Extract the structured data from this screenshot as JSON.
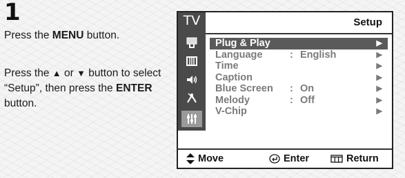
{
  "step": {
    "number": "1"
  },
  "instructions": {
    "p1_pre": "Press the ",
    "p1_bold": "MENU",
    "p1_post": " button.",
    "p2_pre": "Press the ",
    "p2_up": "▲",
    "p2_or": " or ",
    "p2_down": "▼",
    "p2_mid": " button to select “Setup”, then press the ",
    "p2_bold": "ENTER",
    "p2_post": " button."
  },
  "tv_menu": {
    "sidebar_label": "TV",
    "sidebar_icons": [
      "input-icon",
      "picture-icon",
      "sound-icon",
      "channel-icon",
      "setup-icon"
    ],
    "title": "Setup",
    "items": [
      {
        "label": "Plug & Play",
        "colon": "",
        "value": "",
        "arrow": "▶",
        "selected": true
      },
      {
        "label": "Language",
        "colon": ":",
        "value": "English",
        "arrow": "▶",
        "selected": false
      },
      {
        "label": "Time",
        "colon": "",
        "value": "",
        "arrow": "▶",
        "selected": false
      },
      {
        "label": "Caption",
        "colon": "",
        "value": "",
        "arrow": "▶",
        "selected": false
      },
      {
        "label": "Blue Screen",
        "colon": ":",
        "value": "On",
        "arrow": "▶",
        "selected": false
      },
      {
        "label": "Melody",
        "colon": ":",
        "value": "Off",
        "arrow": "▶",
        "selected": false
      },
      {
        "label": "V-Chip",
        "colon": "",
        "value": "",
        "arrow": "▶",
        "selected": false
      }
    ],
    "footer": {
      "move_icon": "up-down-arrow-icon",
      "move_label": "Move",
      "enter_icon": "enter-icon",
      "enter_label": "Enter",
      "return_icon": "return-icon",
      "return_label": "Return"
    }
  }
}
